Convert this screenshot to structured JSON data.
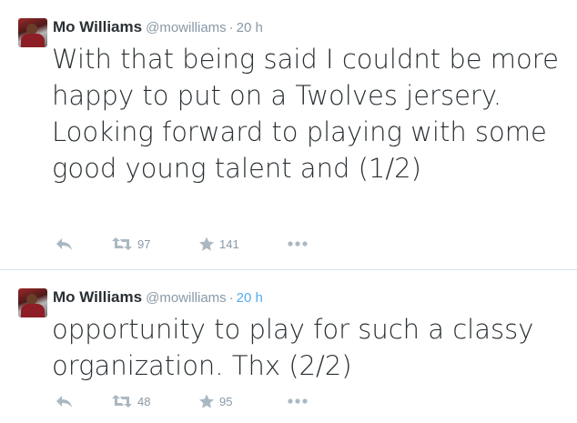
{
  "tweets": [
    {
      "name": "Mo Williams",
      "handle": "@mowilliams",
      "separator": "·",
      "time": "20 h",
      "text": "With that being said I couldnt be more happy to put on a Twolves jersery. Looking forward to playing with some good young talent and (1/2)",
      "retweets": "97",
      "favorites": "141"
    },
    {
      "name": "Mo Williams",
      "handle": "@mowilliams",
      "separator": "·",
      "time": "20 h",
      "text": "opportunity to play for such a classy organization. Thx (2/2)",
      "retweets": "48",
      "favorites": "95"
    }
  ],
  "icons": {
    "reply": "reply-icon",
    "retweet": "retweet-icon",
    "favorite": "star-icon",
    "more": "more-dots-icon"
  },
  "colors": {
    "text": "#292f33",
    "meta": "#8899a6",
    "icon": "#aab8c2",
    "link": "#55acee",
    "divider": "#d7e3ec"
  }
}
